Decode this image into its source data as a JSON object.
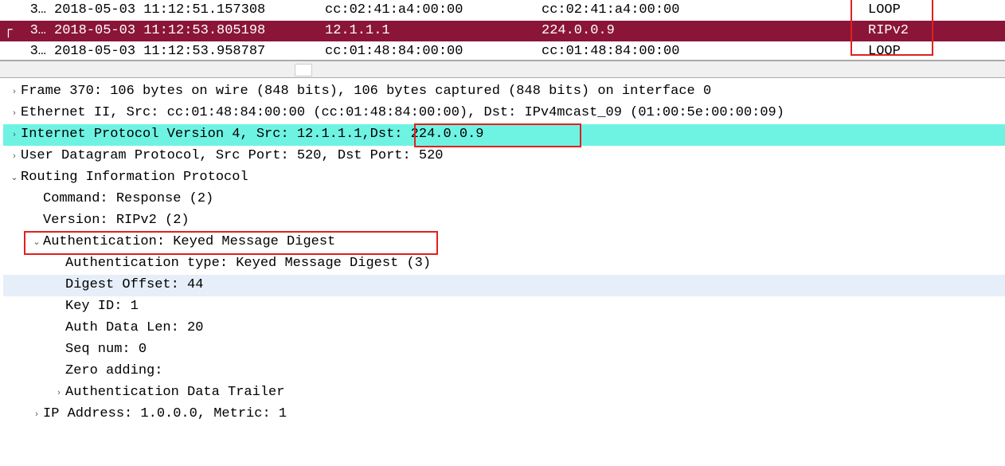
{
  "packet_list": {
    "rows": [
      {
        "no": "3…",
        "time": "2018-05-03 11:12:51.157308",
        "src": "cc:02:41:a4:00:00",
        "dst": "cc:02:41:a4:00:00",
        "proto": "LOOP",
        "selected": false
      },
      {
        "no": "3…",
        "time": "2018-05-03 11:12:53.805198",
        "src": "12.1.1.1",
        "dst": "224.0.0.9",
        "proto": "RIPv2",
        "selected": true
      },
      {
        "no": "3…",
        "time": "2018-05-03 11:12:53.958787",
        "src": "cc:01:48:84:00:00",
        "dst": "cc:01:48:84:00:00",
        "proto": "LOOP",
        "selected": false
      }
    ]
  },
  "details": {
    "frame": "Frame 370: 106 bytes on wire (848 bits), 106 bytes captured (848 bits) on interface 0",
    "ethernet": "Ethernet II, Src: cc:01:48:84:00:00 (cc:01:48:84:00:00), Dst: IPv4mcast_09 (01:00:5e:00:00:09)",
    "ip_prefix": "Internet Protocol Version 4, Src: 12.1.1.1,",
    "ip_dst": " Dst: 224.0.0.9",
    "udp": "User Datagram Protocol, Src Port: 520, Dst Port: 520",
    "rip": "Routing Information Protocol",
    "command": "Command: Response (2)",
    "version": "Version: RIPv2 (2)",
    "auth": "Authentication: Keyed Message Digest",
    "auth_type": "Authentication type: Keyed Message Digest (3)",
    "digest_off": "Digest Offset: 44",
    "key_id": "Key ID: 1",
    "auth_len": "Auth Data Len: 20",
    "seq_num": "Seq num: 0",
    "zero_add": "Zero adding:",
    "auth_trail": "Authentication Data Trailer",
    "ip_addr": "IP Address: 1.0.0.0, Metric: 1"
  }
}
